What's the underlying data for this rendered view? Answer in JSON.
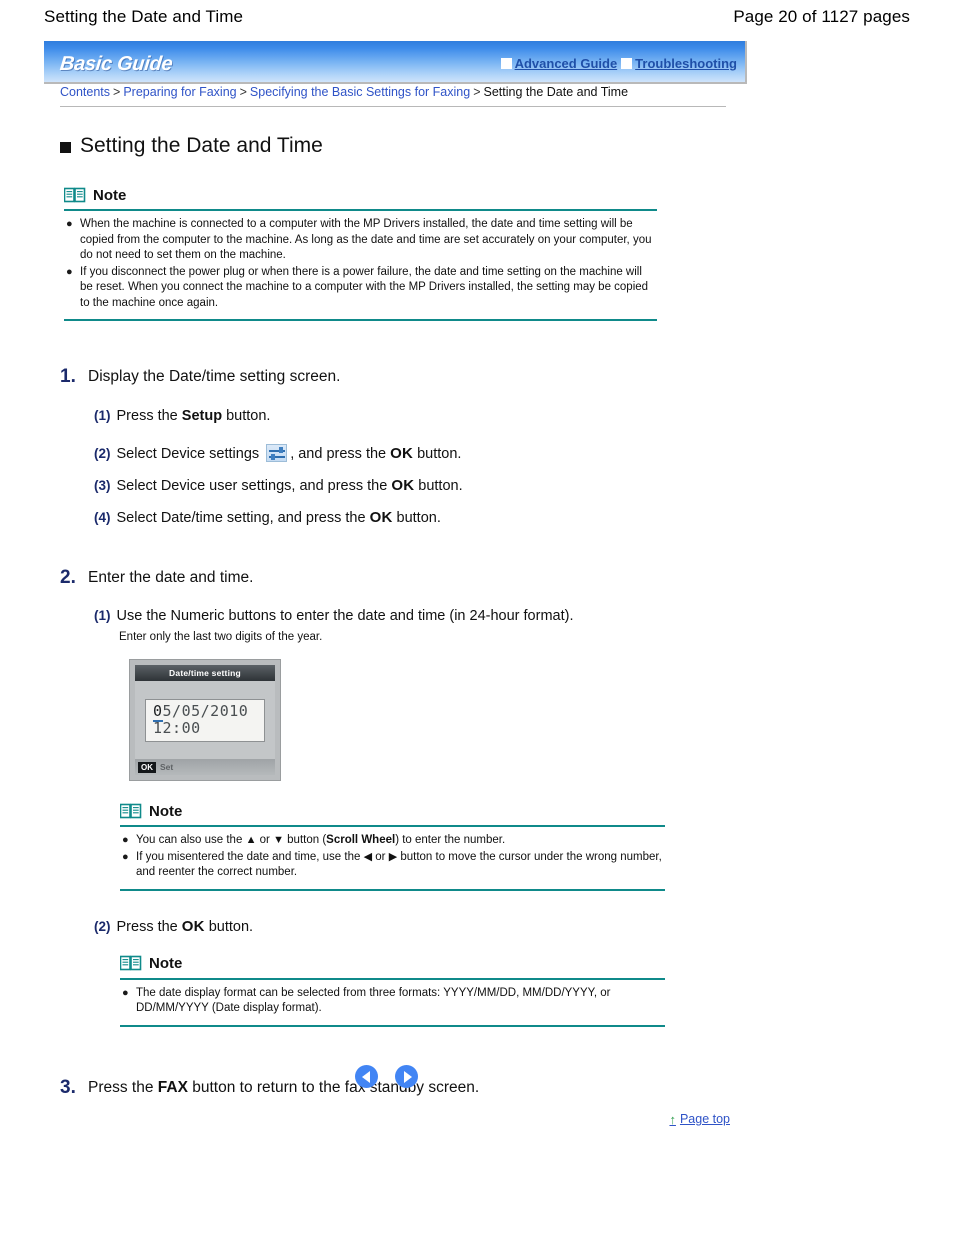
{
  "page_header": {
    "title": "Setting the Date and Time",
    "pages": "Page 20 of 1127 pages"
  },
  "banner": {
    "logo": "Basic Guide",
    "links": [
      {
        "label": "Advanced Guide"
      },
      {
        "label": "Troubleshooting"
      }
    ]
  },
  "breadcrumb": {
    "items": [
      {
        "label": "Contents",
        "link": true
      },
      {
        "label": "Preparing for Faxing",
        "link": true
      },
      {
        "label": "Specifying the Basic Settings for Faxing",
        "link": true
      },
      {
        "label": "Setting the Date and Time",
        "link": false
      }
    ],
    "separator": ">"
  },
  "heading": "Setting the Date and Time",
  "note_title": "Note",
  "note_top": {
    "items": [
      "When the machine is connected to a computer with the MP Drivers installed, the date and time setting will be copied from the computer to the machine. As long as the date and time are set accurately on your computer, you do not need to set them on the machine.",
      "If you disconnect the power plug or when there is a power failure, the date and time setting on the machine will be reset. When you connect the machine to a computer with the MP Drivers installed, the setting may be copied to the machine once again."
    ]
  },
  "step1": {
    "num": "1.",
    "title": "Display the Date/time setting screen.",
    "sub1": {
      "n": "(1)",
      "pre": "Press the ",
      "bold": "Setup",
      "post": " button."
    },
    "sub2": {
      "n": "(2)",
      "pre": "Select Device settings ",
      "icon": "device-settings-icon",
      "mid": ", and press the ",
      "bold": "OK",
      "post": " button."
    },
    "sub3": {
      "n": "(3)",
      "pre": "Select Device user settings, and press the ",
      "bold": "OK",
      "post": " button."
    },
    "sub4": {
      "n": "(4)",
      "pre": "Select Date/time setting, and press the ",
      "bold": "OK",
      "post": " button."
    }
  },
  "step2": {
    "num": "2.",
    "title": "Enter the date and time.",
    "sub1": {
      "n": "(1)",
      "text": "Use the Numeric buttons to enter the date and time (in 24-hour format)."
    },
    "sub1_note": "Enter only the last two digits of the year.",
    "lcd": {
      "title": "Date/time setting",
      "date_cursor": "0",
      "date_rest": "5/05/2010",
      "time": "12:00",
      "ok_badge": "OK",
      "foot_label": "Set"
    },
    "note_mid": {
      "item1": {
        "a": "You can also use the ",
        "up": "▲",
        "b": " or ",
        "down": "▼",
        "c": " button (",
        "bold": "Scroll Wheel",
        "d": ") to enter the number."
      },
      "item2": {
        "a": "If you misentered the date and time, use the ",
        "left": "◀",
        "b": " or ",
        "right": "▶",
        "c": " button to move the cursor under the wrong number, and reenter the correct number."
      }
    },
    "sub2": {
      "n": "(2)",
      "pre": "Press the ",
      "bold": "OK",
      "post": " button."
    },
    "note_bottom": {
      "items": [
        "The date display format can be selected from three formats: YYYY/MM/DD, MM/DD/YYYY, or DD/MM/YYYY (Date display format)."
      ]
    }
  },
  "step3": {
    "num": "3.",
    "pre": "Press the ",
    "bold": "FAX",
    "post": " button to return to the fax standby screen."
  },
  "footer": {
    "prev_label": "Previous page",
    "next_label": "Next page",
    "page_top": "Page top",
    "up_arrow": "↑"
  },
  "colors": {
    "link": "#2f53c7",
    "banner_blue": "#3e8cea",
    "note_rule": "#0f8a8a",
    "step_num": "#1b2a6b",
    "nav_blue": "#4285f4",
    "arrow_green": "#2f9e4f"
  }
}
